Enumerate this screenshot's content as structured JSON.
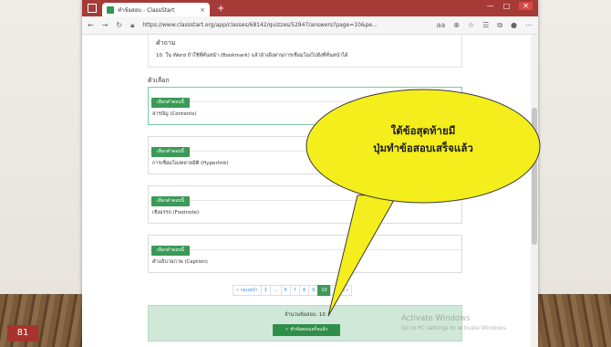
{
  "slide": {
    "number": "81"
  },
  "browser": {
    "tab_title": "ทำข้อสอบ - ClassStart",
    "tab_close": "×",
    "new_tab": "+",
    "url": "https://www.classstart.org/app/classes/68142/quizzes/52947/answers?page=10&pe..."
  },
  "question": {
    "label": "คำถาม",
    "text": "10. ใน Word ถ้าใช้ที่คั่นหน้า (Bookmark) แล้วอ้างอิงผ่านการเชื่อมโยงไปยังที่คั่นหน้าได้"
  },
  "choices": {
    "label": "ตัวเลือก",
    "button_label": "เลือกคำตอบนี้",
    "items": [
      {
        "text": "สารบัญ (Contents)"
      },
      {
        "text": "การเชื่อมโยงหลายมิติ (Hyperlink)"
      },
      {
        "text": "เชิงอรรถ (Footnote)"
      },
      {
        "text": "คำอธิบายภาพ (Caption)"
      }
    ]
  },
  "pagination": {
    "prev": "« ก่อนหน้า",
    "pages": [
      "1",
      "...",
      "6",
      "7",
      "8",
      "9",
      "10"
    ],
    "next": "ถัดไป »",
    "active": "10"
  },
  "summary": {
    "count_text": "จำนวนข้อสอบ: 10",
    "finish_button": "ทำข้อสอบเสร็จแล้ว"
  },
  "annotation": {
    "line1": "ใต้ข้อสุดท้ายมี",
    "line2": "ปุ่มทำข้อสอบเสร็จแล้ว"
  },
  "watermark": {
    "title": "Activate Windows",
    "subtitle": "Go to PC settings to activate Windows."
  },
  "colors": {
    "tab_bar": "#a53a37",
    "accent_green": "#3b9a57",
    "callout_yellow": "#f4ee1c"
  }
}
